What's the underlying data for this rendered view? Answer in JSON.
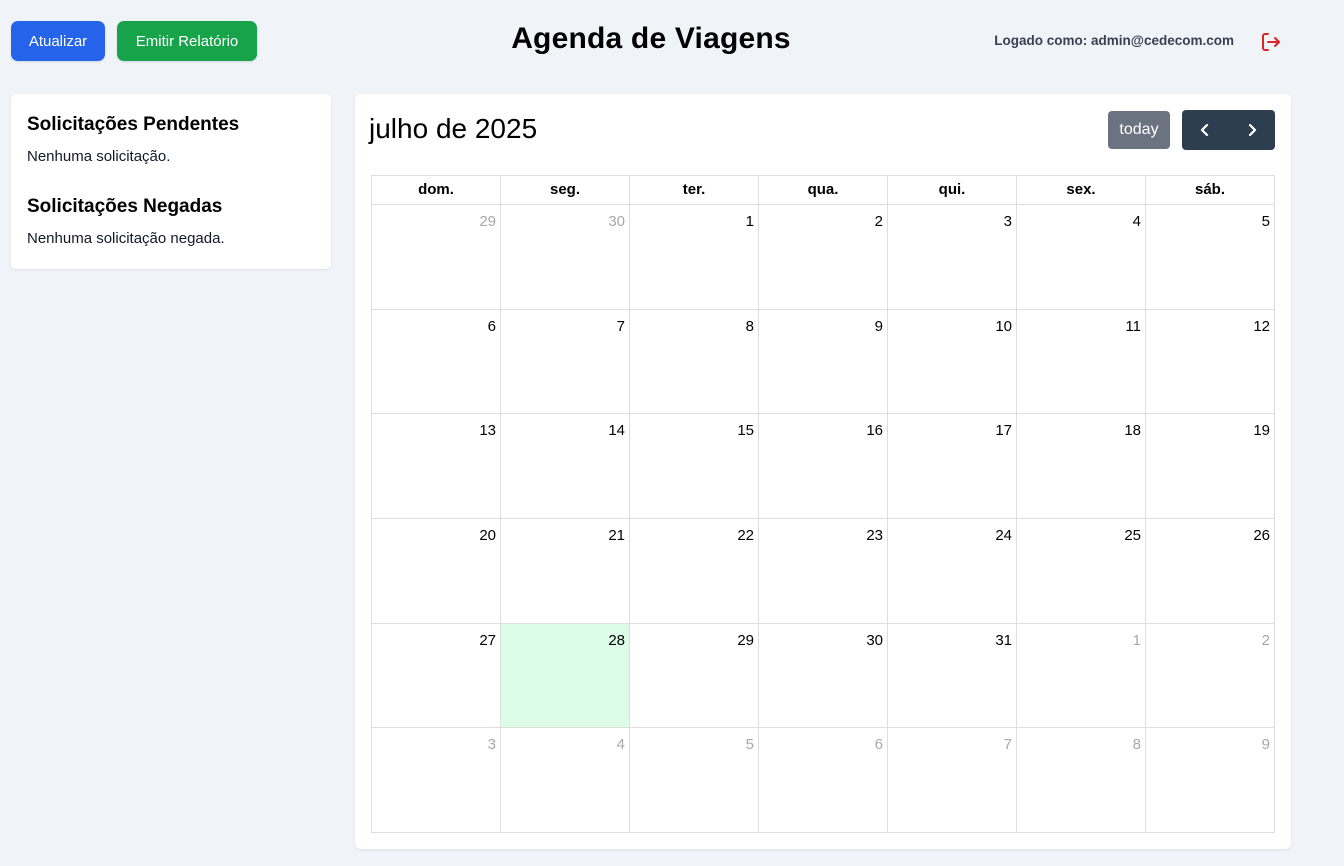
{
  "header": {
    "refresh_label": "Atualizar",
    "report_label": "Emitir Relatório",
    "title": "Agenda de Viagens",
    "user_text": "Logado como: admin@cedecom.com",
    "logout_icon": "logout-icon"
  },
  "sidebar": {
    "pending_title": "Solicitações Pendentes",
    "pending_empty": "Nenhuma solicitação.",
    "denied_title": "Solicitações Negadas",
    "denied_empty": "Nenhuma solicitação negada."
  },
  "calendar": {
    "title": "julho de 2025",
    "today_label": "today",
    "prev_icon": "chevron-left-icon",
    "next_icon": "chevron-right-icon",
    "weekdays": [
      "dom.",
      "seg.",
      "ter.",
      "qua.",
      "qui.",
      "sex.",
      "sáb."
    ],
    "weeks": [
      [
        {
          "d": "29",
          "o": true
        },
        {
          "d": "30",
          "o": true
        },
        {
          "d": "1"
        },
        {
          "d": "2"
        },
        {
          "d": "3"
        },
        {
          "d": "4"
        },
        {
          "d": "5"
        }
      ],
      [
        {
          "d": "6"
        },
        {
          "d": "7"
        },
        {
          "d": "8"
        },
        {
          "d": "9"
        },
        {
          "d": "10"
        },
        {
          "d": "11"
        },
        {
          "d": "12"
        }
      ],
      [
        {
          "d": "13"
        },
        {
          "d": "14"
        },
        {
          "d": "15"
        },
        {
          "d": "16"
        },
        {
          "d": "17"
        },
        {
          "d": "18"
        },
        {
          "d": "19"
        }
      ],
      [
        {
          "d": "20"
        },
        {
          "d": "21"
        },
        {
          "d": "22"
        },
        {
          "d": "23"
        },
        {
          "d": "24"
        },
        {
          "d": "25"
        },
        {
          "d": "26"
        }
      ],
      [
        {
          "d": "27"
        },
        {
          "d": "28",
          "today": true
        },
        {
          "d": "29"
        },
        {
          "d": "30"
        },
        {
          "d": "31"
        },
        {
          "d": "1",
          "o": true
        },
        {
          "d": "2",
          "o": true
        }
      ],
      [
        {
          "d": "3",
          "o": true
        },
        {
          "d": "4",
          "o": true
        },
        {
          "d": "5",
          "o": true
        },
        {
          "d": "6",
          "o": true
        },
        {
          "d": "7",
          "o": true
        },
        {
          "d": "8",
          "o": true
        },
        {
          "d": "9",
          "o": true
        }
      ]
    ]
  },
  "colors": {
    "refresh_button": "#2563eb",
    "report_button": "#16a34a",
    "logout_icon": "#dc2626",
    "today_cell": "#dcfce7",
    "nav_group": "#2c3e50",
    "today_button": "#6b7280"
  }
}
